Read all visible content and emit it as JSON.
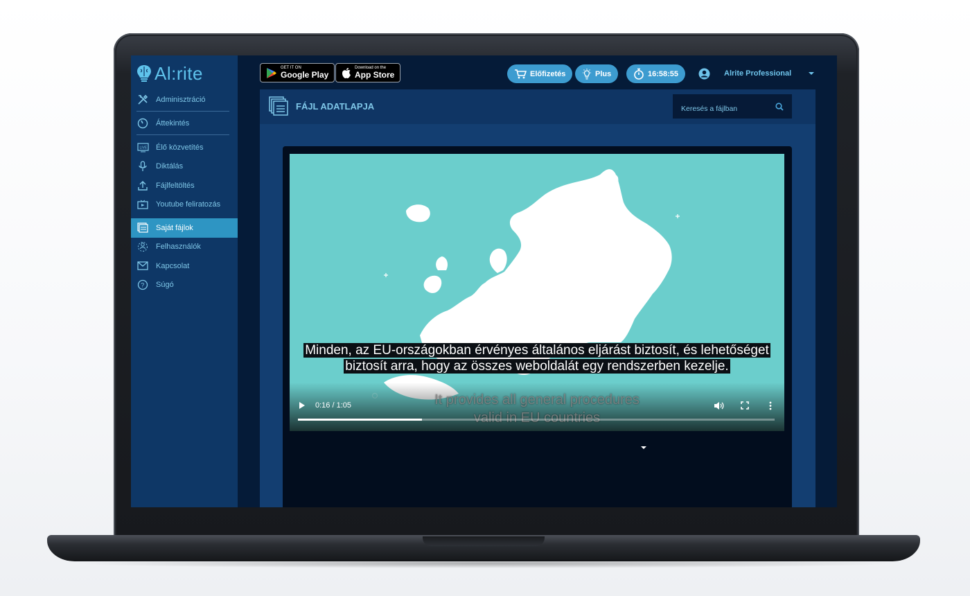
{
  "brand": {
    "name": "Al:rite"
  },
  "sidebar": {
    "items": [
      {
        "label": "Adminisztráció",
        "icon": "tools-icon"
      },
      {
        "label": "Áttekintés",
        "icon": "gauge-icon"
      },
      {
        "label": "Élő közvetítés",
        "icon": "live-icon"
      },
      {
        "label": "Diktálás",
        "icon": "microphone-icon"
      },
      {
        "label": "Fájlfeltöltés",
        "icon": "upload-icon"
      },
      {
        "label": "Youtube feliratozás",
        "icon": "youtube-icon"
      },
      {
        "label": "Saját fájlok",
        "icon": "files-icon",
        "active": true
      },
      {
        "label": "Felhasználók",
        "icon": "users-icon"
      },
      {
        "label": "Kapcsolat",
        "icon": "envelope-icon"
      },
      {
        "label": "Súgó",
        "icon": "help-icon"
      }
    ]
  },
  "topbar": {
    "google_play": {
      "small": "GET IT ON",
      "big": "Google Play"
    },
    "app_store": {
      "small": "Download on the",
      "big": "App Store"
    },
    "subscription_label": "Előfizetés",
    "plus_label": "Plus",
    "timer": "16:58:55",
    "user_name": "Alrite Professional"
  },
  "panel": {
    "title": "FÁJL ADATLAPJA",
    "search_placeholder": "Keresés a fájlban"
  },
  "video": {
    "subtitle": "Minden, az EU-országokban érvényes általános eljárást biztosít, és lehetőséget biztosít arra, hogy az összes weboldalát egy rendszerben kezelje.",
    "burned_caption_line1": "It provides all general procedures",
    "burned_caption_line2": "valid in EU countries",
    "time_display": "0:16 / 1:05",
    "progress_fraction": 0.26
  },
  "colors": {
    "sidebar_bg": "#0e3766",
    "accent": "#2e95c3",
    "pill": "#3d9cd0",
    "text_accent": "#7fc7e8",
    "video_bg": "#6bcecc"
  }
}
